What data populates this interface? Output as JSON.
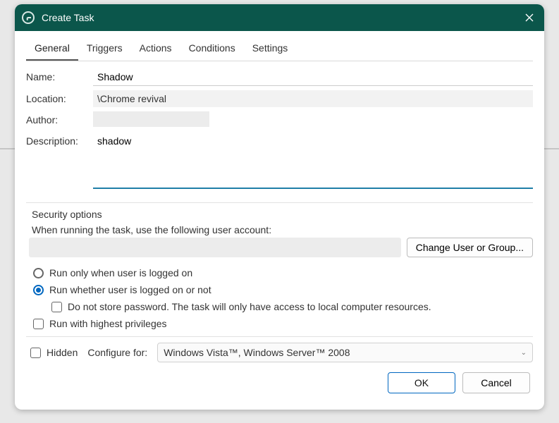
{
  "titlebar": {
    "title": "Create Task"
  },
  "tabs": {
    "general": "General",
    "triggers": "Triggers",
    "actions": "Actions",
    "conditions": "Conditions",
    "settings": "Settings"
  },
  "form": {
    "name_label": "Name:",
    "name_value": "Shadow",
    "location_label": "Location:",
    "location_value": "\\Chrome revival",
    "author_label": "Author:",
    "author_value": "",
    "description_label": "Description:",
    "description_value": "shadow"
  },
  "security": {
    "heading": "Security options",
    "account_prompt": "When running the task, use the following user account:",
    "change_user_label": "Change User or Group...",
    "run_logged_on": "Run only when user is logged on",
    "run_whether": "Run whether user is logged on or not",
    "no_store_pw": "Do not store password.  The task will only have access to local computer resources.",
    "highest_priv": "Run with highest privileges"
  },
  "bottom": {
    "hidden_label": "Hidden",
    "configure_label": "Configure for:",
    "configure_value": "Windows Vista™, Windows Server™ 2008"
  },
  "footer": {
    "ok": "OK",
    "cancel": "Cancel"
  }
}
